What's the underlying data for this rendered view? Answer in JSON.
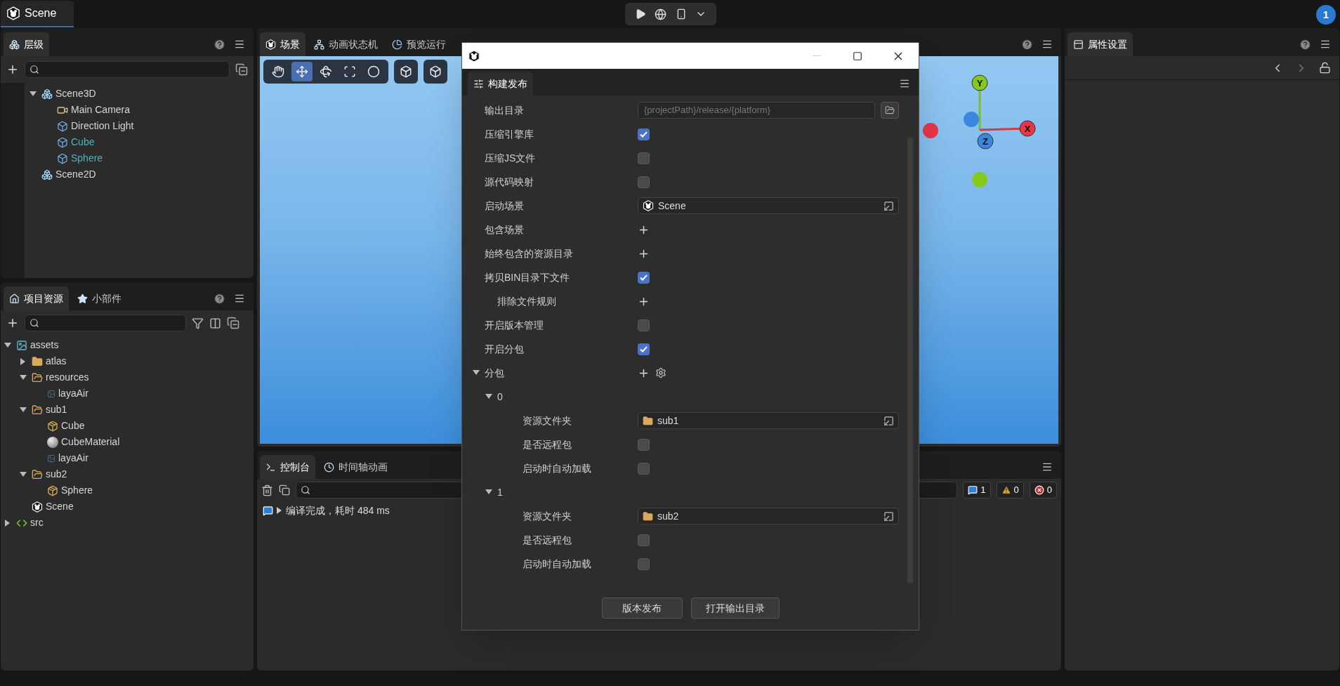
{
  "top_bar": {
    "scene_tab": "Scene",
    "notification_count": "1"
  },
  "hierarchy": {
    "tab": "层级",
    "tree": [
      {
        "label": "Scene3D",
        "kind": "scene3d",
        "highlighted": false,
        "expanded": true,
        "children": [
          {
            "label": "Main Camera",
            "kind": "camera",
            "highlighted": false
          },
          {
            "label": "Direction Light",
            "kind": "node",
            "highlighted": false
          },
          {
            "label": "Cube",
            "kind": "node",
            "highlighted": true
          },
          {
            "label": "Sphere",
            "kind": "node",
            "highlighted": true
          }
        ]
      },
      {
        "label": "Scene2D",
        "kind": "scene3d",
        "highlighted": false
      }
    ]
  },
  "assets": {
    "tabs": [
      {
        "label": "项目资源",
        "kind": "home",
        "selected": true
      },
      {
        "label": "小部件",
        "kind": "star",
        "selected": false
      }
    ],
    "tree": [
      {
        "label": "assets",
        "kind": "image_folder",
        "highlighted": false,
        "expanded": true,
        "children": [
          {
            "label": "atlas",
            "kind": "folder",
            "highlighted": false,
            "expanded": false
          },
          {
            "label": "resources",
            "kind": "folder_open",
            "highlighted": false,
            "expanded": true,
            "children": [
              {
                "label": "layaAir",
                "kind": "image",
                "highlighted": false
              }
            ]
          },
          {
            "label": "sub1",
            "kind": "folder_open",
            "highlighted": false,
            "expanded": true,
            "children": [
              {
                "label": "Cube",
                "kind": "prefab",
                "highlighted": false
              },
              {
                "label": "CubeMaterial",
                "kind": "material",
                "highlighted": false
              },
              {
                "label": "layaAir",
                "kind": "image",
                "highlighted": false
              }
            ]
          },
          {
            "label": "sub2",
            "kind": "folder_open",
            "highlighted": false,
            "expanded": true,
            "children": [
              {
                "label": "Sphere",
                "kind": "prefab",
                "highlighted": false
              }
            ]
          },
          {
            "label": "Scene",
            "kind": "scene",
            "highlighted": false
          }
        ]
      },
      {
        "label": "src",
        "kind": "code",
        "highlighted": false,
        "expanded": false
      }
    ]
  },
  "scene_panel": {
    "tabs": [
      {
        "label": "场景",
        "kind": "scene",
        "selected": true
      },
      {
        "label": "动画状态机",
        "kind": "graph",
        "selected": false
      },
      {
        "label": "预览运行",
        "kind": "preview",
        "selected": false
      }
    ],
    "tools": [
      {
        "kind": "hand",
        "selected": false
      },
      {
        "kind": "move",
        "selected": true
      },
      {
        "kind": "rotate",
        "selected": false
      },
      {
        "kind": "scale",
        "selected": false
      },
      {
        "kind": "rect",
        "selected": false
      }
    ],
    "gizmo": {
      "y": "Y",
      "z": "Z",
      "x": "X"
    }
  },
  "console": {
    "tabs": [
      {
        "label": "控制台",
        "kind": "console",
        "selected": true
      },
      {
        "label": "时间轴动画",
        "kind": "clock",
        "selected": false
      }
    ],
    "messages": [
      {
        "text": "编译完成，耗时 484 ms",
        "expanded": false
      }
    ],
    "counts": [
      {
        "kind": "info",
        "count": "1"
      },
      {
        "kind": "warning",
        "count": "0"
      },
      {
        "kind": "error",
        "count": "0"
      }
    ]
  },
  "properties": {
    "tab": "属性设置"
  },
  "dialog": {
    "tab": "构建发布",
    "rows": [
      {
        "kind": "path",
        "label": "输出目录",
        "value": "{projectPath}/release/{platform}"
      },
      {
        "kind": "checkbox",
        "label": "压缩引擎库",
        "checked": true
      },
      {
        "kind": "checkbox",
        "label": "压缩JS文件",
        "checked": false
      },
      {
        "kind": "checkbox",
        "label": "源代码映射",
        "checked": false
      },
      {
        "kind": "scene_asset",
        "label": "启动场景",
        "value": "Scene"
      },
      {
        "kind": "add",
        "label": "包含场景"
      },
      {
        "kind": "add",
        "label": "始终包含的资源目录"
      },
      {
        "kind": "checkbox",
        "label": "拷贝BIN目录下文件",
        "checked": true,
        "children": [
          {
            "kind": "add",
            "label": "排除文件规则"
          }
        ]
      },
      {
        "kind": "checkbox",
        "label": "开启版本管理",
        "checked": false
      },
      {
        "kind": "checkbox",
        "label": "开启分包",
        "checked": true
      },
      {
        "kind": "add_settings",
        "label": "分包",
        "expanded": true,
        "children": [
          {
            "kind": "group",
            "label": "0",
            "expanded": true,
            "children": [
              {
                "kind": "folder_asset",
                "label": "资源文件夹",
                "value": "sub1"
              },
              {
                "kind": "checkbox",
                "label": "是否远程包",
                "checked": false
              },
              {
                "kind": "checkbox",
                "label": "启动时自动加载",
                "checked": false
              }
            ]
          },
          {
            "kind": "group",
            "label": "1",
            "expanded": true,
            "children": [
              {
                "kind": "folder_asset",
                "label": "资源文件夹",
                "value": "sub2"
              },
              {
                "kind": "checkbox",
                "label": "是否远程包",
                "checked": false
              },
              {
                "kind": "checkbox",
                "label": "启动时自动加载",
                "checked": false
              }
            ]
          }
        ]
      }
    ],
    "buttons": [
      "版本发布",
      "打开输出目录"
    ]
  }
}
